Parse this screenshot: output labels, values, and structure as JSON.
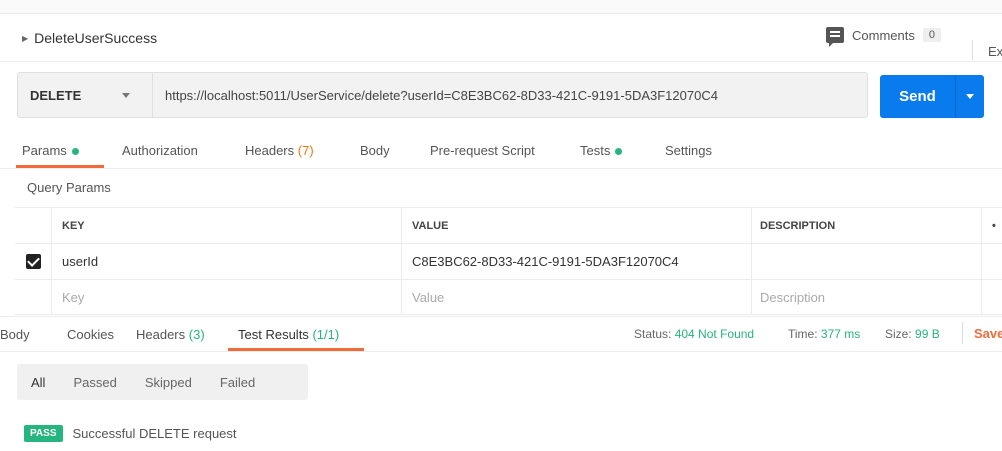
{
  "request": {
    "name": "DeleteUserSuccess",
    "method": "DELETE",
    "url": "https://localhost:5011/UserService/delete?userId=C8E3BC62-8D33-421C-9191-5DA3F12070C4",
    "send_label": "Send"
  },
  "header": {
    "comments_label": "Comments",
    "comments_count": "0",
    "export_label": "Ex"
  },
  "request_tabs": [
    {
      "label": "Params",
      "dot": true
    },
    {
      "label": "Authorization"
    },
    {
      "label": "Headers",
      "count": "(7)"
    },
    {
      "label": "Body"
    },
    {
      "label": "Pre-request Script"
    },
    {
      "label": "Tests",
      "dot": true
    },
    {
      "label": "Settings"
    }
  ],
  "query_params": {
    "title": "Query Params",
    "headers": {
      "key": "KEY",
      "value": "VALUE",
      "description": "DESCRIPTION"
    },
    "rows": [
      {
        "checked": true,
        "key": "userId",
        "value": "C8E3BC62-8D33-421C-9191-5DA3F12070C4",
        "description": ""
      }
    ],
    "placeholders": {
      "key": "Key",
      "value": "Value",
      "description": "Description"
    }
  },
  "response_tabs": [
    {
      "label": "Body"
    },
    {
      "label": "Cookies"
    },
    {
      "label": "Headers",
      "count": "(3)"
    },
    {
      "label": "Test Results",
      "count": "(1/1)"
    }
  ],
  "response_status": {
    "status_label": "Status:",
    "status_value": "404 Not Found",
    "time_label": "Time:",
    "time_value": "377 ms",
    "size_label": "Size:",
    "size_value": "99 B",
    "save_label": "Save"
  },
  "test_filters": [
    "All",
    "Passed",
    "Skipped",
    "Failed"
  ],
  "test_results": [
    {
      "status": "PASS",
      "name": "Successful DELETE request"
    }
  ],
  "colors": {
    "accent": "#f26b3a",
    "send": "#097bed",
    "success": "#26b47f",
    "count_orange": "#e97a14"
  }
}
